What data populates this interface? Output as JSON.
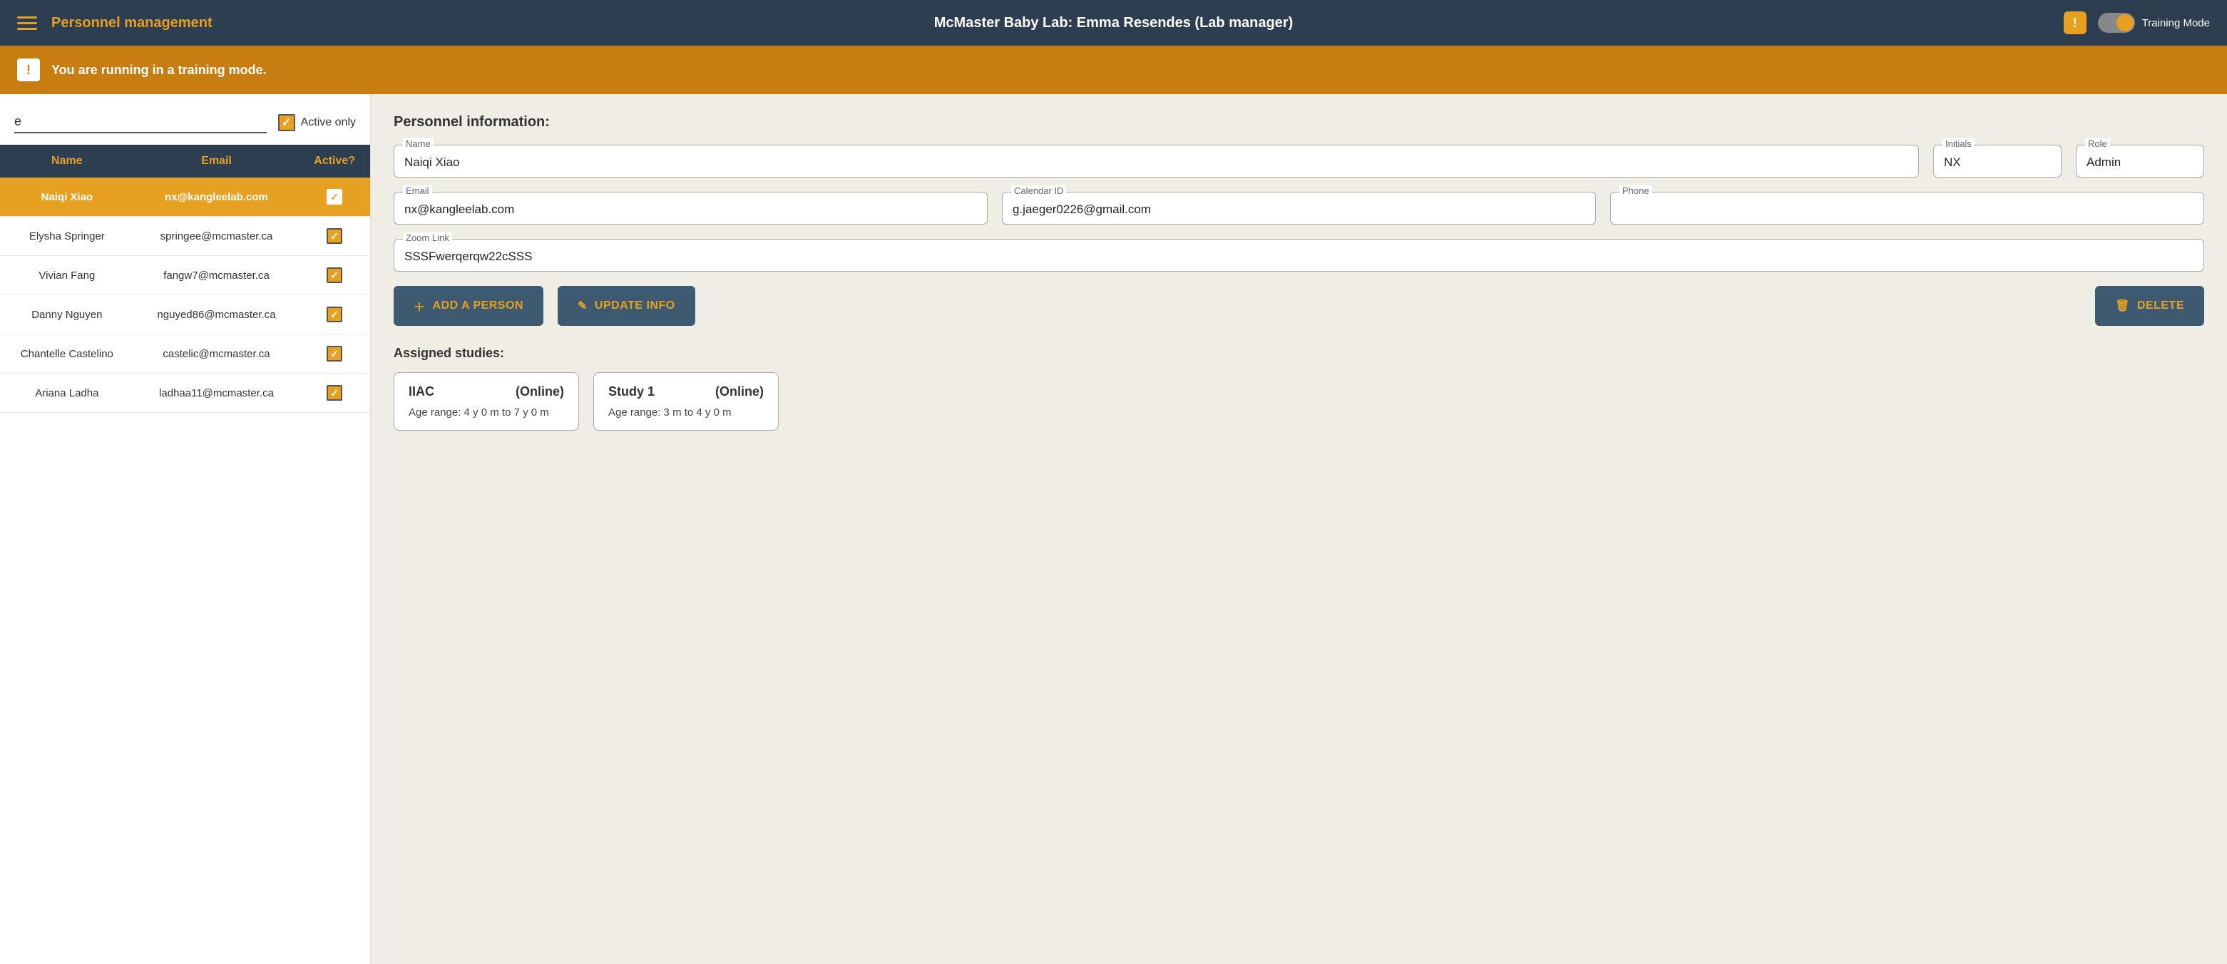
{
  "nav": {
    "title": "Personnel management",
    "center": "McMaster Baby Lab: Emma Resendes (Lab manager)",
    "training_mode_label": "Training Mode",
    "alert_icon": "!"
  },
  "training_banner": {
    "icon": "!",
    "message": "You are running in a training mode."
  },
  "left_panel": {
    "search_value": "e",
    "search_placeholder": "",
    "active_only_label": "Active only",
    "table": {
      "columns": [
        "Name",
        "Email",
        "Active?"
      ],
      "rows": [
        {
          "name": "Naiqi Xiao",
          "email": "nx@kangleelab.com",
          "active": true,
          "selected": true
        },
        {
          "name": "Elysha Springer",
          "email": "springee@mcmaster.ca",
          "active": true,
          "selected": false
        },
        {
          "name": "Vivian Fang",
          "email": "fangw7@mcmaster.ca",
          "active": true,
          "selected": false
        },
        {
          "name": "Danny Nguyen",
          "email": "nguyed86@mcmaster.ca",
          "active": true,
          "selected": false
        },
        {
          "name": "Chantelle Castelino",
          "email": "castelic@mcmaster.ca",
          "active": true,
          "selected": false
        },
        {
          "name": "Ariana Ladha",
          "email": "ladhaa11@mcmaster.ca",
          "active": true,
          "selected": false
        }
      ]
    }
  },
  "right_panel": {
    "section_title": "Personnel information:",
    "fields": {
      "name_label": "Name",
      "name_value": "Naiqi Xiao",
      "initials_label": "Initials",
      "initials_value": "NX",
      "role_label": "Role",
      "role_value": "Admin",
      "email_label": "Email",
      "email_value": "nx@kangleelab.com",
      "calendar_id_label": "Calendar ID",
      "calendar_id_value": "g.jaeger0226@gmail.com",
      "phone_label": "Phone",
      "phone_value": "",
      "zoom_link_label": "Zoom Link",
      "zoom_link_value": "SSSFwerqerqw22cSSS"
    },
    "buttons": {
      "add_label": "+ ADD A PERSON",
      "update_label": "✎  UPDATE INFO",
      "delete_label": "🗑  DELETE"
    },
    "assigned_studies_title": "Assigned studies:",
    "studies": [
      {
        "name": "IIAC",
        "mode": "(Online)",
        "age_range": "Age range: 4 y 0 m to 7 y 0 m"
      },
      {
        "name": "Study 1",
        "mode": "(Online)",
        "age_range": "Age range: 3 m to 4 y 0 m"
      }
    ]
  }
}
